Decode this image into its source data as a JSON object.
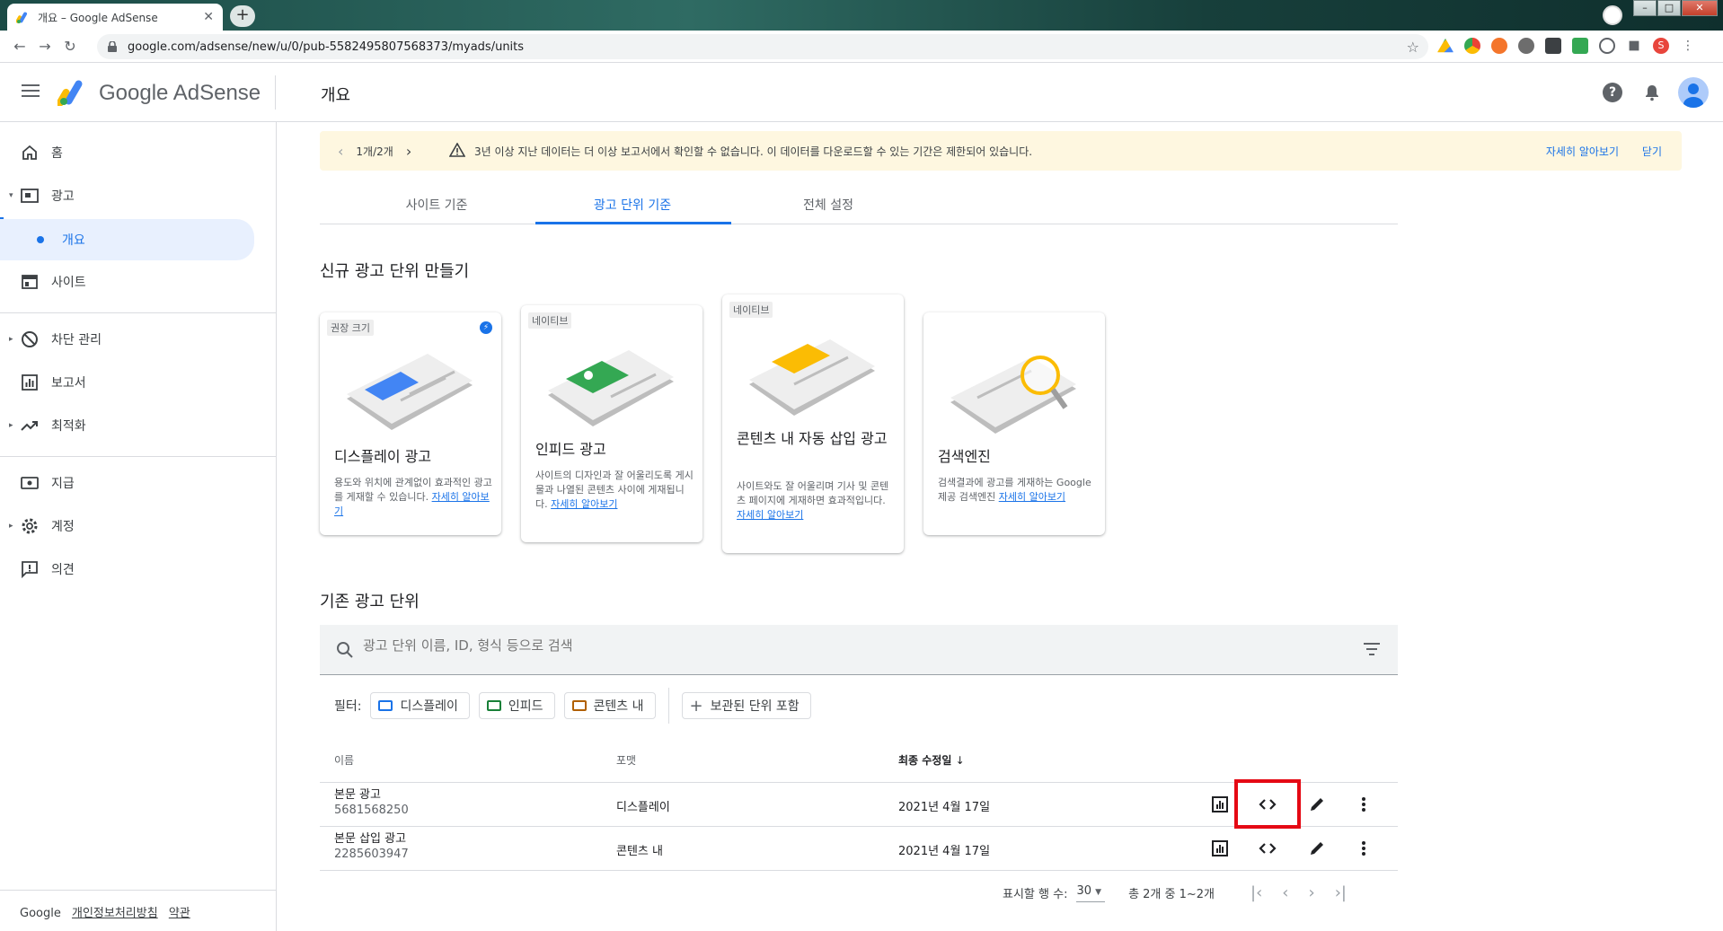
{
  "browser": {
    "tab_title": "개요 – Google AdSense",
    "url": "google.com/adsense/new/u/0/pub-5582495807568373/myads/units",
    "profile_letter": "S"
  },
  "app": {
    "brand": "Google AdSense",
    "page_title": "개요"
  },
  "sidebar": {
    "items": [
      {
        "label": "홈"
      },
      {
        "label": "광고"
      },
      {
        "label": "개요"
      },
      {
        "label": "사이트"
      },
      {
        "label": "차단 관리"
      },
      {
        "label": "보고서"
      },
      {
        "label": "최적화"
      },
      {
        "label": "지급"
      },
      {
        "label": "계정"
      },
      {
        "label": "의견"
      }
    ],
    "footer": {
      "google": "Google",
      "privacy": "개인정보처리방침",
      "terms": "약관"
    }
  },
  "banner": {
    "page": "1개/2개",
    "message": "3년 이상 지난 데이터는 더 이상 보고서에서 확인할 수 없습니다. 이 데이터를 다운로드할 수 있는 기간은 제한되어 있습니다.",
    "learn_more": "자세히 알아보기",
    "close": "닫기"
  },
  "tabs": [
    {
      "label": "사이트 기준"
    },
    {
      "label": "광고 단위 기준"
    },
    {
      "label": "전체 설정"
    }
  ],
  "create_section": {
    "title": "신규 광고 단위 만들기",
    "cards": [
      {
        "chip": "권장 크기",
        "title": "디스플레이 광고",
        "desc": "용도와 위치에 관계없이 효과적인 광고를 게재할 수 있습니다.",
        "link": "자세히 알아보기"
      },
      {
        "chip": "네이티브",
        "title": "인피드 광고",
        "desc": "사이트의 디자인과 잘 어울리도록 게시물과 나열된 콘텐츠 사이에 게재됩니다.",
        "link": "자세히 알아보기"
      },
      {
        "chip": "네이티브",
        "title": "콘텐츠 내 자동 삽입 광고",
        "desc": "사이트와도 잘 어울리며 기사 및 콘텐츠 페이지에 게재하면 효과적입니다.",
        "link": "자세히 알아보기"
      },
      {
        "chip": "",
        "title": "검색엔진",
        "desc": "검색결과에 광고를 게재하는 Google 제공 검색엔진",
        "link": "자세히 알아보기"
      }
    ]
  },
  "existing_section": {
    "title": "기존 광고 단위",
    "search_placeholder": "광고 단위 이름, ID, 형식 등으로 검색",
    "filter_label": "필터:",
    "filters": [
      {
        "label": "디스플레이",
        "color": "#1a73e8"
      },
      {
        "label": "인피드",
        "color": "#188038"
      },
      {
        "label": "콘텐츠 내",
        "color": "#b06000"
      }
    ],
    "include_archived": "보관된 단위 포함",
    "columns": {
      "name": "이름",
      "format": "포맷",
      "modified": "최종 수정일"
    },
    "rows": [
      {
        "name": "본문 광고",
        "id": "5681568250",
        "format": "디스플레이",
        "modified": "2021년 4월 17일"
      },
      {
        "name": "본문 삽입 광고",
        "id": "2285603947",
        "format": "콘텐츠 내",
        "modified": "2021년 4월 17일"
      }
    ],
    "pager": {
      "rows_label": "표시할 행 수:",
      "rows_value": "30",
      "range": "총 2개 중 1~2개"
    }
  },
  "colors": {
    "accent": "#1a73e8",
    "banner_bg": "#fef7e0",
    "highlight": "#e50914"
  }
}
